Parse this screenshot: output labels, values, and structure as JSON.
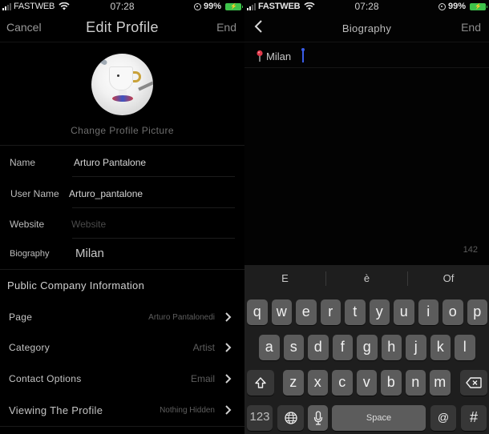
{
  "status_bar": {
    "carrier": "FASTWEB",
    "time": "07:28",
    "battery": "99%",
    "icons": [
      "signal-icon",
      "wifi-icon",
      "orientation-lock-icon",
      "battery-icon"
    ]
  },
  "edit_profile": {
    "nav": {
      "cancel": "Cancel",
      "title": "Edit Profile",
      "end": "End"
    },
    "change_picture": "Change Profile Picture",
    "fields": [
      {
        "label": "Name",
        "value": "Arturo Pantalone",
        "placeholder": ""
      },
      {
        "label": "User Name",
        "value": "Arturo_pantalone",
        "placeholder": ""
      },
      {
        "label": "Website",
        "value": "",
        "placeholder": "Website"
      },
      {
        "label": "Biography",
        "value": "Milan",
        "placeholder": ""
      }
    ],
    "section_title": "Public Company Information",
    "links": [
      {
        "label": "Page",
        "value": "Arturo Pantalonedi"
      },
      {
        "label": "Category",
        "value": "Artist"
      },
      {
        "label": "Contact Options",
        "value": "Email"
      },
      {
        "label": "Viewing The Profile",
        "value": "Nothing Hidden"
      }
    ]
  },
  "biography": {
    "nav": {
      "title": "Biography",
      "end": "End",
      "back_icon": "chevron-left-icon"
    },
    "text": "Milan",
    "pin_icon": "round-pushpin-icon",
    "char_count": "142",
    "keyboard": {
      "suggestions": [
        "E",
        "è",
        "Of"
      ],
      "rows": [
        [
          "q",
          "w",
          "e",
          "r",
          "t",
          "y",
          "u",
          "i",
          "o",
          "p"
        ],
        [
          "a",
          "s",
          "d",
          "f",
          "g",
          "h",
          "j",
          "k",
          "l"
        ],
        [
          "z",
          "x",
          "c",
          "v",
          "b",
          "n",
          "m"
        ]
      ],
      "numbers_key": "123",
      "space_key": "Space",
      "at_key": "@",
      "hash_key": "#",
      "special_icons": [
        "shift-icon",
        "backspace-icon",
        "globe-icon",
        "microphone-icon"
      ]
    }
  },
  "colors": {
    "background": "#000000",
    "keyboard_bg": "#1e1e1e",
    "key": "#5c5c5c",
    "key_dark": "#373737",
    "caret": "#3a5de8",
    "battery": "#3ec44b"
  }
}
